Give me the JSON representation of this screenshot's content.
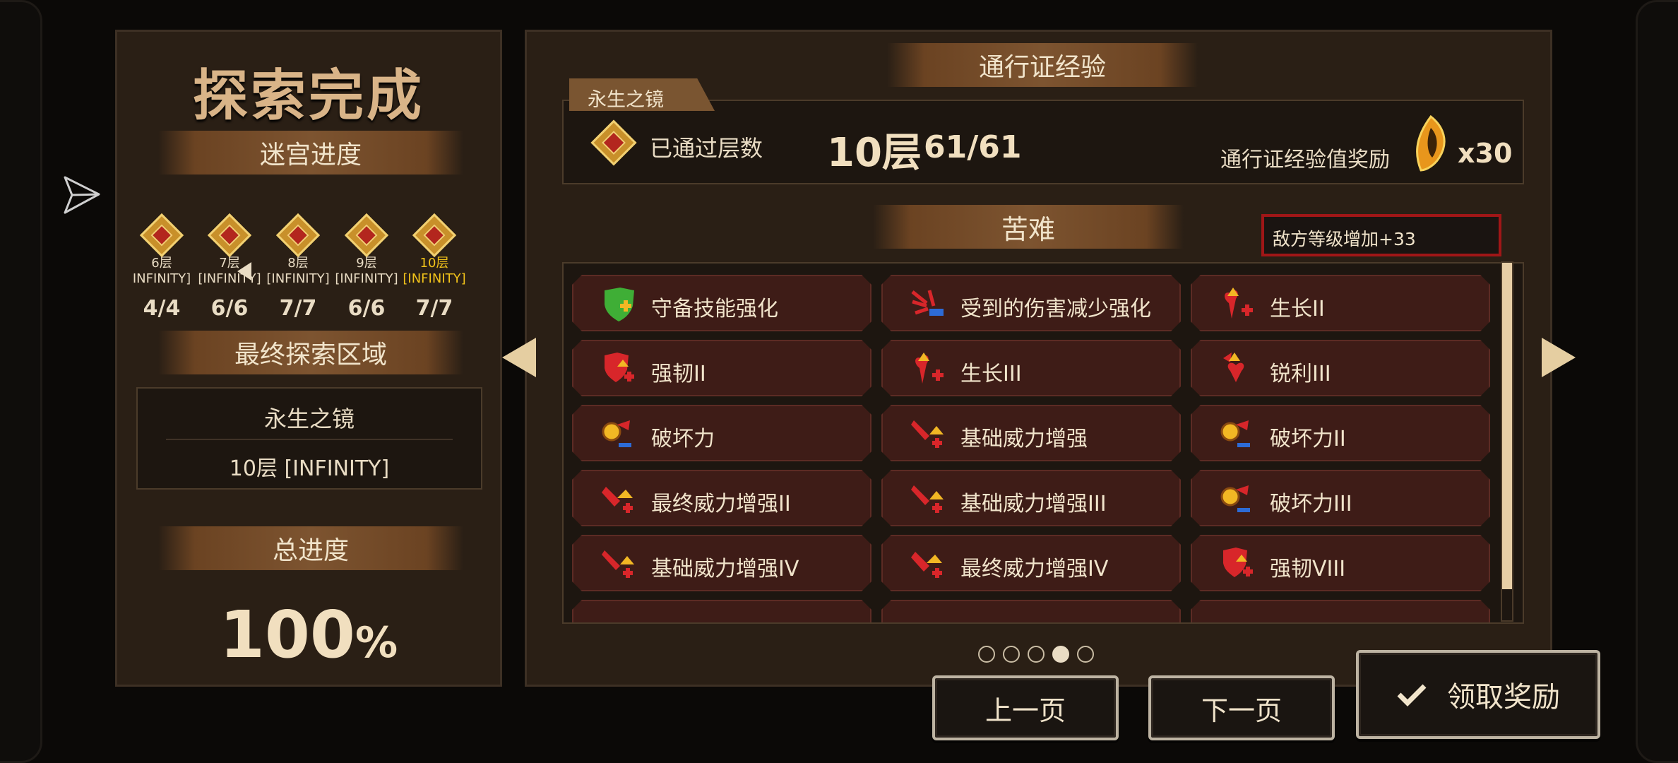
{
  "left": {
    "title": "探索完成",
    "maze_progress_label": "迷宫进度",
    "floors": [
      {
        "name": "6层",
        "tag": "INFINITY]",
        "count": "4/4",
        "active": false
      },
      {
        "name": "7层",
        "tag": "[INFINITY]",
        "count": "6/6",
        "active": false
      },
      {
        "name": "8层",
        "tag": "[INFINITY]",
        "count": "7/7",
        "active": false
      },
      {
        "name": "9层",
        "tag": "[INFINITY]",
        "count": "6/6",
        "active": false
      },
      {
        "name": "10层",
        "tag": "[INFINITY]",
        "count": "7/7",
        "active": true
      }
    ],
    "final_area_label": "最终探索区域",
    "final_area_name": "永生之镜",
    "final_area_floor": "10层 [INFINITY]",
    "total_progress_label": "总进度",
    "total_progress_value": "100",
    "total_progress_unit": "%"
  },
  "right": {
    "pass_exp_title": "通行证经验",
    "realm_tab": "永生之镜",
    "passed_floors_label": "已通过层数",
    "floor_value": "10层",
    "kills_value": "61/61",
    "exp_reward_label": "通行证经验值奖励",
    "exp_multiplier": "x30",
    "hardship_title": "苦难",
    "enemy_level_text": "敌方等级增加+33",
    "modifiers": [
      {
        "label": "守备技能强化",
        "icon": "shield-plus-icon"
      },
      {
        "label": "受到的伤害减少强化",
        "icon": "damage-reduce-icon"
      },
      {
        "label": "生长II",
        "icon": "growth-icon"
      },
      {
        "label": "强韧II",
        "icon": "toughness-icon"
      },
      {
        "label": "生长III",
        "icon": "growth-icon"
      },
      {
        "label": "锐利III",
        "icon": "sharp-icon"
      },
      {
        "label": "破坏力",
        "icon": "destruction-icon"
      },
      {
        "label": "基础威力增强",
        "icon": "base-power-icon"
      },
      {
        "label": "破坏力II",
        "icon": "destruction-icon"
      },
      {
        "label": "最终威力增强II",
        "icon": "final-power-icon"
      },
      {
        "label": "基础威力增强III",
        "icon": "base-power-icon"
      },
      {
        "label": "破坏力III",
        "icon": "destruction-icon"
      },
      {
        "label": "基础威力增强IV",
        "icon": "base-power-icon"
      },
      {
        "label": "最终威力增强IV",
        "icon": "final-power-icon"
      },
      {
        "label": "强韧VIII",
        "icon": "toughness-icon"
      }
    ],
    "page_count": 5,
    "current_page": 4
  },
  "buttons": {
    "prev": "上一页",
    "next": "下一页",
    "claim": "领取奖励"
  },
  "colors": {
    "accent_gold": "#f2c31a",
    "card_bg": "#3e1c17",
    "enemy_border": "#a01617"
  }
}
